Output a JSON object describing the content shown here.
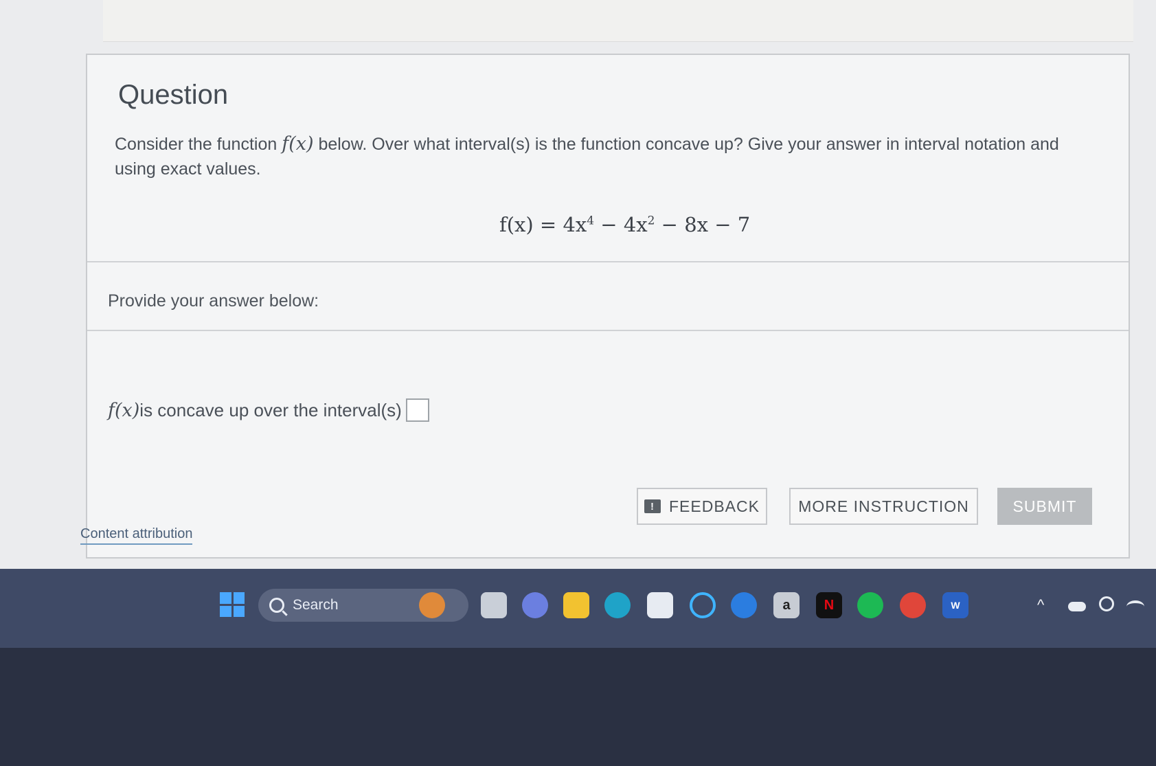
{
  "question": {
    "title": "Question",
    "text_before": "Consider the function ",
    "fx": "f(x)",
    "text_after": " below. Over what interval(s) is the function concave up? Give your answer in interval notation and using exact values.",
    "equation_lhs": "f(x) = 4x",
    "exp1": "4",
    "equation_mid": " − 4x",
    "exp2": "2",
    "equation_rhs": " − 8x − 7"
  },
  "answer": {
    "provide_label": "Provide your answer below:",
    "fx": "f(x)",
    "label": " is concave up over the interval(s)",
    "value": ""
  },
  "buttons": {
    "feedback": "FEEDBACK",
    "feedback_icon": "!",
    "more_instruction": "MORE INSTRUCTION",
    "submit": "SUBMIT"
  },
  "footer": {
    "attribution": "Content attribution"
  },
  "taskbar": {
    "search_label": "Search",
    "amazon_glyph": "a",
    "netflix_glyph": "N",
    "word_glyph": "W",
    "tray_chevron": "^"
  }
}
